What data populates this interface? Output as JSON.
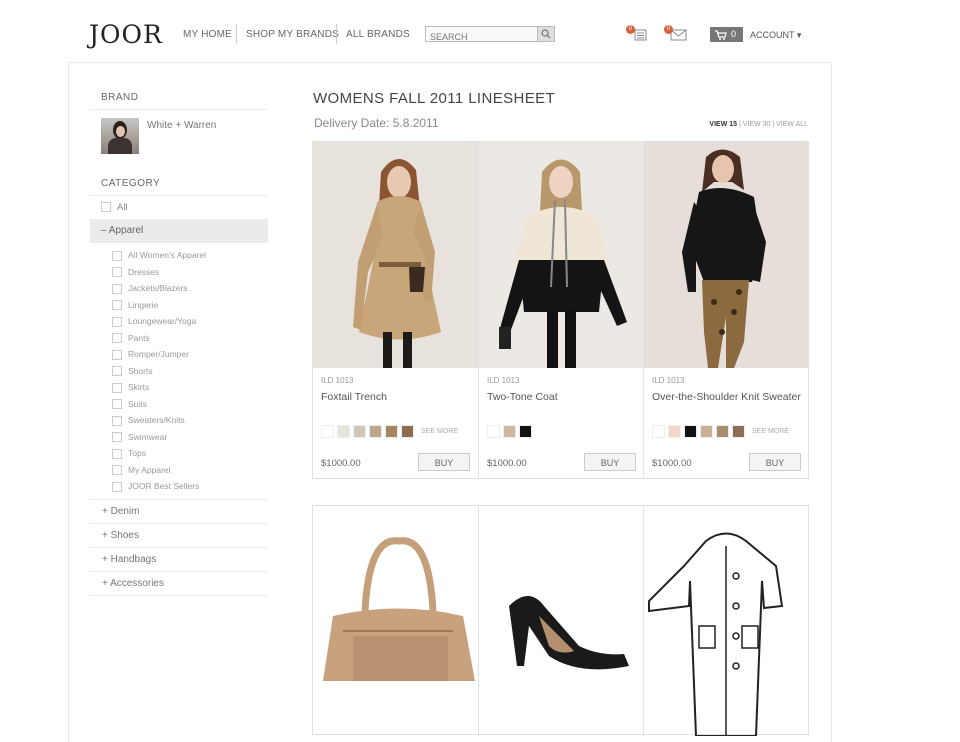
{
  "header": {
    "logo": "JOOR",
    "nav": [
      "MY HOME",
      "SHOP MY BRANDS",
      "ALL BRANDS"
    ],
    "search_placeholder": "SEARCH",
    "notifications_count": "0",
    "messages_count": "0",
    "cart_count": "0",
    "account_label": "ACCOUNT ▾"
  },
  "sidebar": {
    "brand_heading": "BRAND",
    "brand_name": "White + Warren",
    "category_heading": "CATEGORY",
    "all_label": "All",
    "apparel_label": "– Apparel",
    "apparel_items": [
      "All Women's Apparel",
      "Dresses",
      "Jackets/Blazers",
      "Lingerie",
      "Loungewear/Yoga",
      "Pants",
      "Romper/Jumper",
      "Shorts",
      "Skirts",
      "Suits",
      "Sweaters/Knits",
      "Swimwear",
      "Tops",
      "My Apparel",
      "JOOR Best Sellers"
    ],
    "collapsed": [
      "+ Denim",
      "+ Shoes",
      "+ Handbags",
      "+ Accessories"
    ]
  },
  "main": {
    "title": "WOMENS FALL 2011 LINESHEET",
    "delivery": "Delivery Date: 5.8.2011",
    "view_15": "VIEW 15",
    "view_30": "VIEW 30",
    "view_all": "VIEW ALL",
    "products": [
      {
        "sku": "ILD 1013",
        "name": "Foxtail Trench",
        "price": "$1000.00",
        "buy": "BUY",
        "see_more": "SEE MORE",
        "swatches": [
          "#ffffff",
          "#e6e2dc",
          "#cfc7b9",
          "#bda88d",
          "#a58665",
          "#8b6b52"
        ]
      },
      {
        "sku": "ILD 1013",
        "name": "Two-Tone Coat",
        "price": "$1000.00",
        "buy": "BUY",
        "see_more": "",
        "swatches": [
          "#ffffff",
          "#cdb7a0",
          "#111111"
        ]
      },
      {
        "sku": "ILD 1013",
        "name": "Over-the-Shoulder Knit Sweater",
        "price": "$1000.00",
        "buy": "BUY",
        "see_more": "SEE MORE",
        "swatches": [
          "#ffffff",
          "#f1d6cc",
          "#111111",
          "#c9b195",
          "#a88e6f",
          "#8f6c55"
        ]
      }
    ]
  }
}
